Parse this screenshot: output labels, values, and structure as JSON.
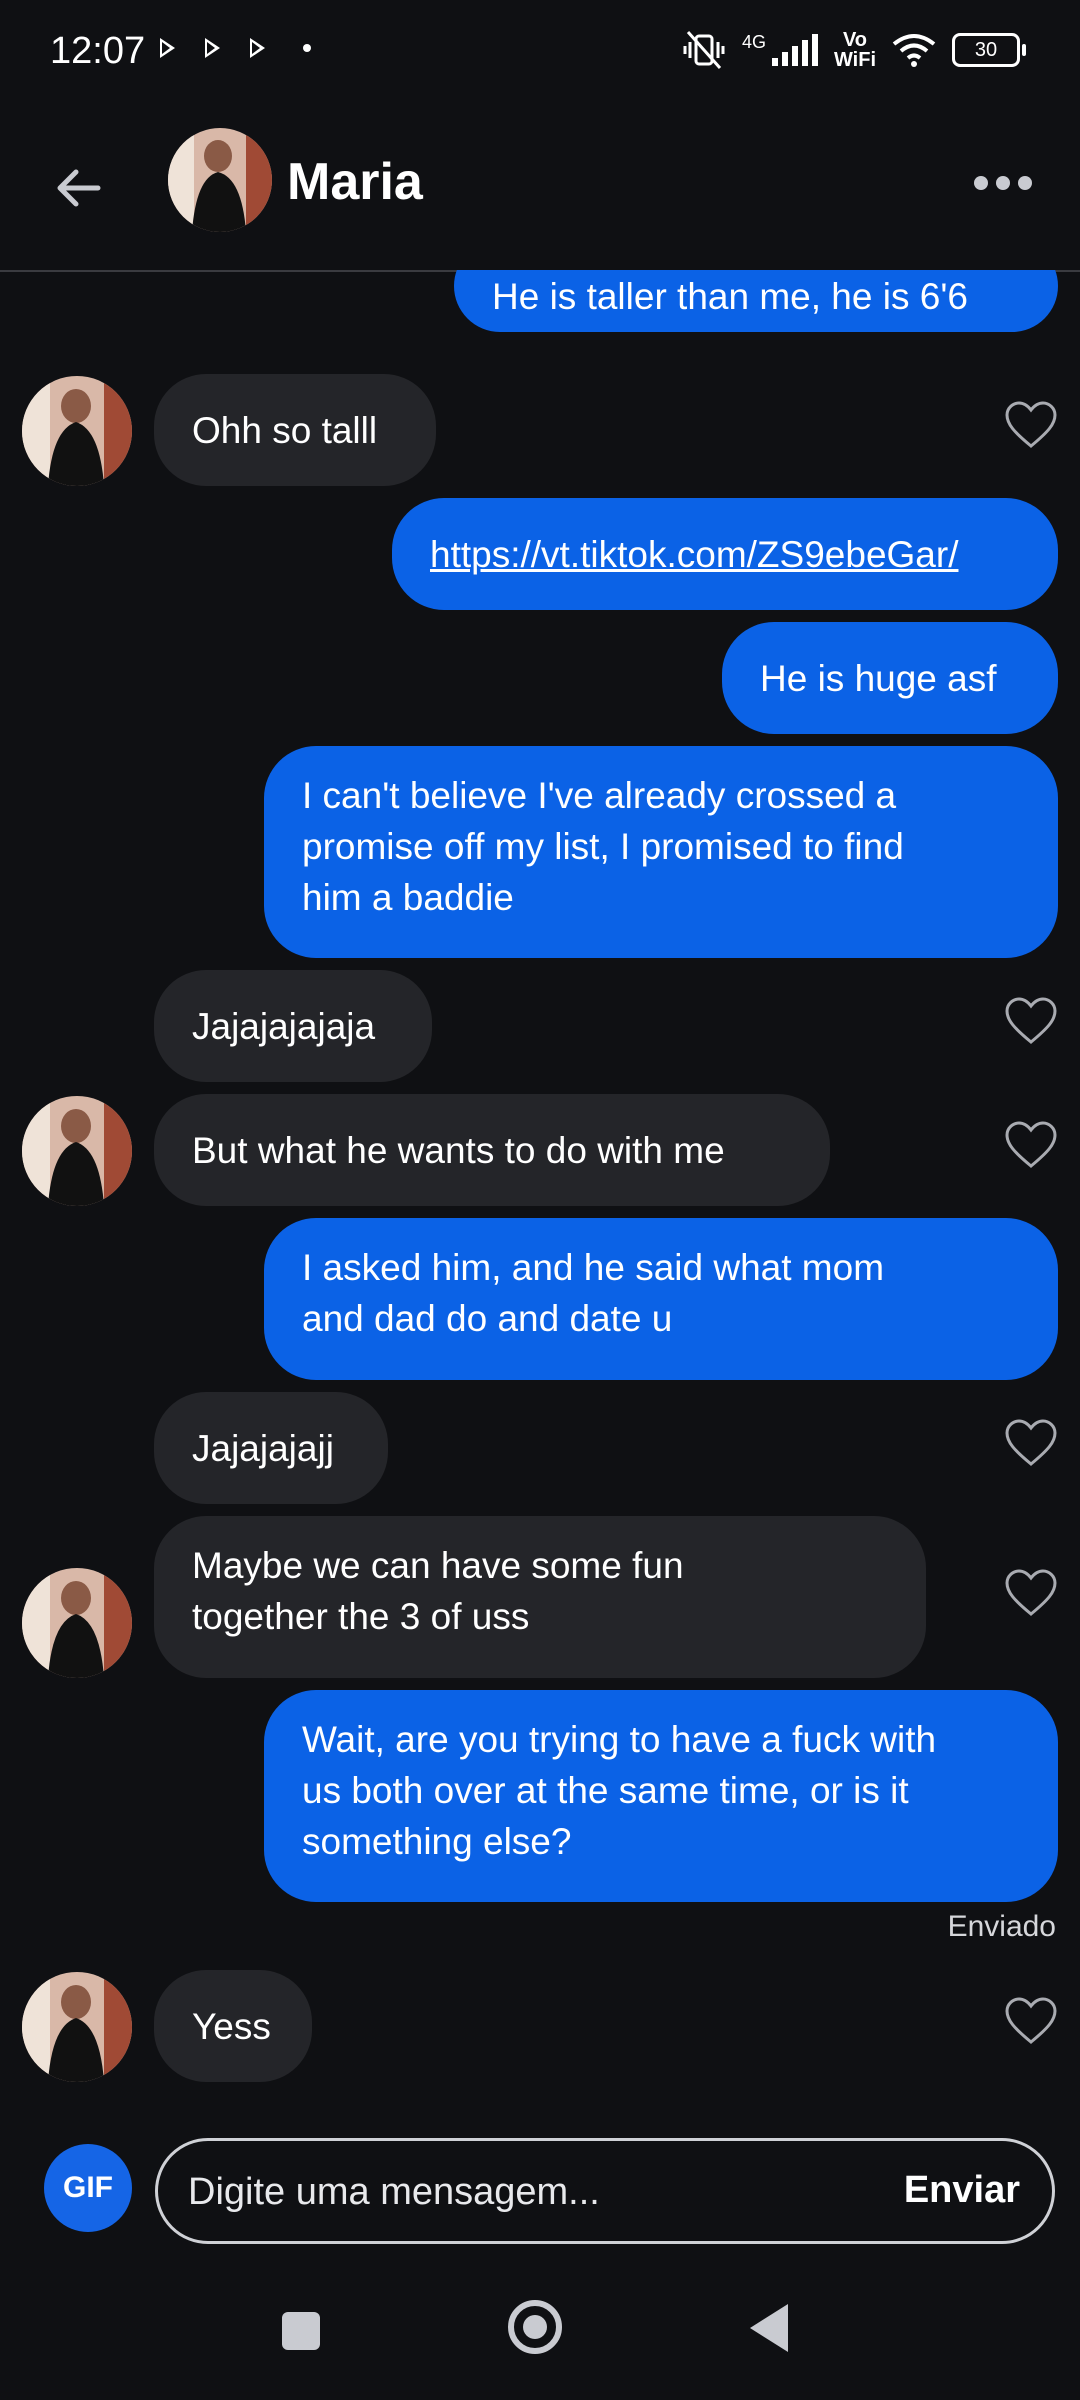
{
  "status_bar": {
    "time": "12:07",
    "network": "4G",
    "vowifi_top": "Vo",
    "vowifi_bottom": "WiFi",
    "battery": "30"
  },
  "header": {
    "contact_name": "Maria"
  },
  "messages": [
    {
      "direction": "out",
      "text": [
        "He is taller than me, he is 6'6"
      ]
    },
    {
      "direction": "in",
      "text": [
        "Ohh so talll"
      ],
      "avatar": true,
      "liked": false
    },
    {
      "direction": "out",
      "text": [
        "https://vt.tiktok.com/ZS9ebeGar/"
      ],
      "link": true
    },
    {
      "direction": "out",
      "text": [
        "He is huge asf"
      ]
    },
    {
      "direction": "out",
      "text": [
        "I can't believe I've already crossed a",
        "promise off my list, I promised to find",
        "him a baddie"
      ]
    },
    {
      "direction": "in",
      "text": [
        "Jajajajajaja"
      ],
      "avatar": false,
      "liked": false
    },
    {
      "direction": "in",
      "text": [
        "But what he wants to do with me"
      ],
      "avatar": true,
      "liked": false
    },
    {
      "direction": "out",
      "text": [
        "I asked him, and he said what mom",
        "and dad do and date u"
      ]
    },
    {
      "direction": "in",
      "text": [
        "Jajajajajj"
      ],
      "avatar": false,
      "liked": false
    },
    {
      "direction": "in",
      "text": [
        "Maybe we can have some fun",
        "together the 3 of uss"
      ],
      "avatar": true,
      "liked": false
    },
    {
      "direction": "out",
      "text": [
        "Wait, are you trying to have a fuck with",
        "us both over at the same time, or is it",
        "something else?"
      ],
      "status": "Enviado"
    },
    {
      "direction": "in",
      "text": [
        "Yess"
      ],
      "avatar": true,
      "liked": false
    }
  ],
  "composer": {
    "gif_label": "GIF",
    "placeholder": "Digite uma mensagem...",
    "send_label": "Enviar"
  },
  "icons": {
    "back": "arrow-left-icon",
    "more": "more-horizontal-icon",
    "heart": "heart-outline-icon",
    "nav_recent": "square-icon",
    "nav_home": "circle-icon",
    "nav_back": "triangle-back-icon"
  },
  "colors": {
    "background": "#0f1013",
    "outgoing_bubble": "#0b62e6",
    "incoming_bubble": "#242529",
    "gif_button": "#1565e6"
  }
}
